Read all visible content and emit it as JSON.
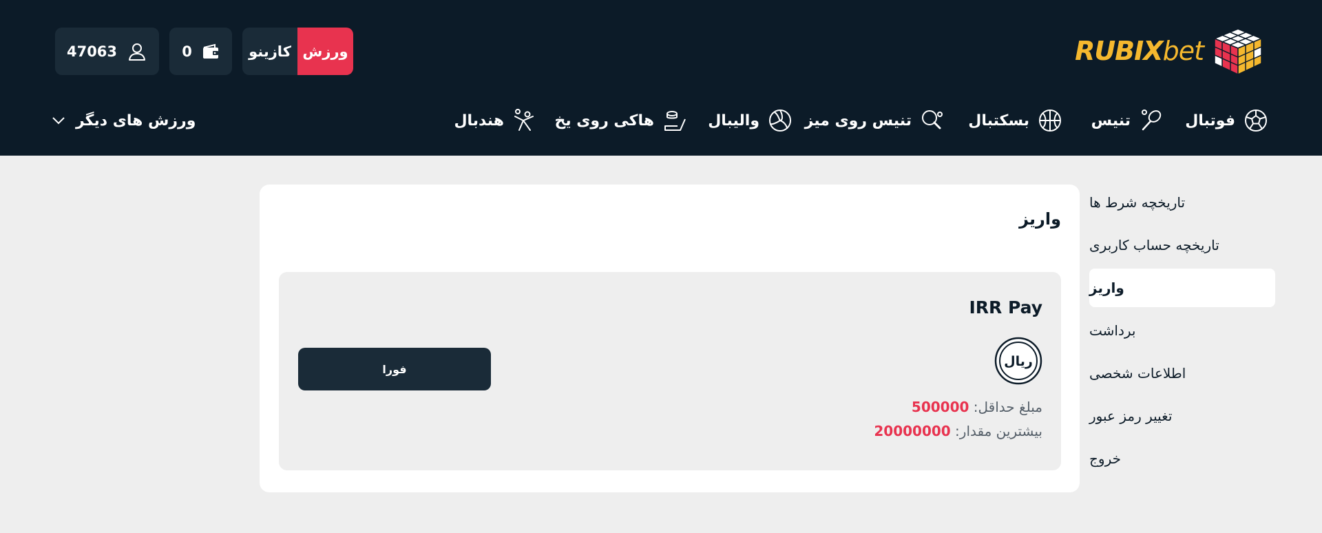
{
  "brand": {
    "logo_main": "RUBIX",
    "logo_suffix": "bet"
  },
  "topbar": {
    "sport_tab": "ورزش",
    "casino_tab": "کازینو",
    "wallet_balance": "0",
    "user_id": "47063"
  },
  "nav": {
    "items": [
      {
        "label": "فوتبال",
        "icon": "soccer-ball-icon"
      },
      {
        "label": "تنیس",
        "icon": "tennis-racket-icon"
      },
      {
        "label": "بسکتبال",
        "icon": "basketball-icon"
      },
      {
        "label": "تنیس روی میز",
        "icon": "ping-pong-icon"
      },
      {
        "label": "والیبال",
        "icon": "volleyball-icon"
      },
      {
        "label": "هاکی روی یخ",
        "icon": "ice-hockey-icon"
      },
      {
        "label": "هندبال",
        "icon": "handball-icon"
      }
    ],
    "more_label": "ورزش های دیگر"
  },
  "sidebar": {
    "items": [
      {
        "label": "تاریخچه شرط ها"
      },
      {
        "label": "تاریخچه حساب کاربری"
      },
      {
        "label": "واریز",
        "active": true
      },
      {
        "label": "برداشت"
      },
      {
        "label": "اطلاعات شخصی"
      },
      {
        "label": "تغییر رمز عبور"
      },
      {
        "label": "خروج"
      }
    ]
  },
  "main": {
    "title": "واریز",
    "method": {
      "name": "IRR Pay",
      "icon_text": "ریال",
      "min_label": "مبلغ حداقل:",
      "min_value": "500000",
      "max_label": "بیشترین مقدار:",
      "max_value": "20000000",
      "button_label": "فورا"
    }
  },
  "colors": {
    "header_bg": "#0c1b28",
    "button_bg": "#1a2b38",
    "accent_red": "#e8334f",
    "logo_gold": "#f5b82e",
    "page_bg": "#eeeeee"
  }
}
